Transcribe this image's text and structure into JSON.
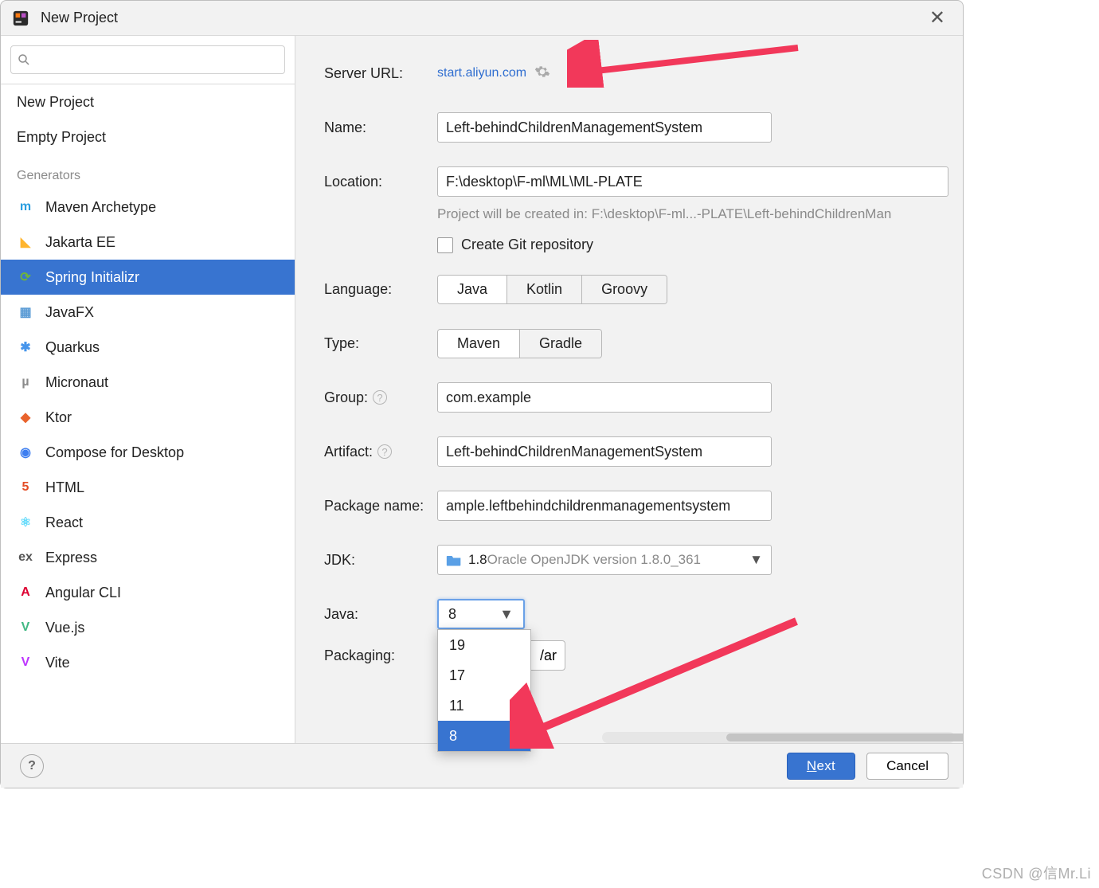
{
  "title": "New Project",
  "sidebar": {
    "items_top": [
      {
        "label": "New Project"
      },
      {
        "label": "Empty Project"
      }
    ],
    "generators_heading": "Generators",
    "generators": [
      {
        "label": "Maven Archetype",
        "color": "#2a9ee0",
        "mark": "m"
      },
      {
        "label": "Jakarta EE",
        "color": "#ffb52e",
        "mark": "◣"
      },
      {
        "label": "Spring Initializr",
        "color": "#6db33f",
        "mark": "⟳",
        "selected": true
      },
      {
        "label": "JavaFX",
        "color": "#5a9bd5",
        "mark": "▦"
      },
      {
        "label": "Quarkus",
        "color": "#4695eb",
        "mark": "✱"
      },
      {
        "label": "Micronaut",
        "color": "#8a8a8a",
        "mark": "µ"
      },
      {
        "label": "Ktor",
        "color": "#e9632c",
        "mark": "◆"
      },
      {
        "label": "Compose for Desktop",
        "color": "#3d7ef0",
        "mark": "◉"
      },
      {
        "label": "HTML",
        "color": "#e44d26",
        "mark": "5"
      },
      {
        "label": "React",
        "color": "#61dafb",
        "mark": "⚛"
      },
      {
        "label": "Express",
        "color": "#555555",
        "mark": "ex"
      },
      {
        "label": "Angular CLI",
        "color": "#dd0031",
        "mark": "A"
      },
      {
        "label": "Vue.js",
        "color": "#41b883",
        "mark": "V"
      },
      {
        "label": "Vite",
        "color": "#bd34fe",
        "mark": "V"
      }
    ]
  },
  "form": {
    "server_url_label": "Server URL:",
    "server_url": "start.aliyun.com",
    "name_label": "Name:",
    "name_value": "Left-behindChildrenManagementSystem",
    "location_label": "Location:",
    "location_value": "F:\\desktop\\F-ml\\ML\\ML-PLATE",
    "location_hint": "Project will be created in: F:\\desktop\\F-ml...-PLATE\\Left-behindChildrenMan",
    "create_git_label": "Create Git repository",
    "language_label": "Language:",
    "language_opts": [
      "Java",
      "Kotlin",
      "Groovy"
    ],
    "type_label": "Type:",
    "type_opts": [
      "Maven",
      "Gradle"
    ],
    "group_label": "Group:",
    "group_value": "com.example",
    "artifact_label": "Artifact:",
    "artifact_value": "Left-behindChildrenManagementSystem",
    "package_label": "Package name:",
    "package_value": "ample.leftbehindchildrenmanagementsystem",
    "jdk_label": "JDK:",
    "jdk_prefix": "1.8",
    "jdk_value": " Oracle OpenJDK version 1.8.0_361",
    "java_label": "Java:",
    "java_selected": "8",
    "java_options": [
      "19",
      "17",
      "11",
      "8"
    ],
    "packaging_label": "Packaging:",
    "packaging_visible": "/ar"
  },
  "footer": {
    "next": "Next",
    "cancel": "Cancel"
  },
  "watermark": "CSDN @信Mr.Li"
}
